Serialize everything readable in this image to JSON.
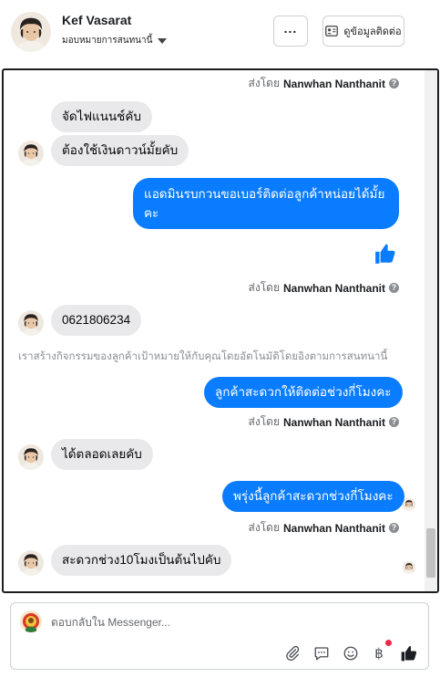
{
  "header": {
    "name": "Kef Vasarat",
    "assign_label": "มอบหมายการสนทนานี้",
    "more_label": "...",
    "contact_button_label": "ดูข้อมูลติดต่อ"
  },
  "sent_by": {
    "prefix": "ส่งโดย",
    "name": "Nanwhan Nanthanit",
    "info_glyph": "?"
  },
  "messages": {
    "m1": "จัดไฟแนนช์คับ",
    "m2": "ต้องใช้เงินดาวน์มั้ยคับ",
    "m3_line1": "แอดมินรบกวนขอเบอร์ติดต่อลูกค้าหน่อยได้มั้ย",
    "m3_line2": "คะ",
    "m4": "0621806234",
    "system_note": "เราสร้างกิจกรรมของลูกค้าเป้าหมายให้กับคุณโดยอัตโนมัติโดยอิงตามการสนทนานี้",
    "m5": "ลูกค้าสะดวกให้ติดต่อช่วงกี่โมงคะ",
    "m6": "ได้ตลอดเลยคับ",
    "m7": "พรุ่งนี้ลูกค้าสะดวกช่วงกี่โมงคะ",
    "m8": "สะดวกช่วง10โมงเป็นต้นไปคับ"
  },
  "composer": {
    "placeholder": "ตอบกลับใน Messenger...",
    "currency_glyph": "฿"
  },
  "colors": {
    "outgoing_bubble": "#0a7cff",
    "incoming_bubble": "#e9e9eb",
    "notification_dot": "#f02849"
  },
  "icons": [
    "avatar",
    "chevron-down-icon",
    "more-icon",
    "contact-card-icon",
    "info-icon",
    "thumbs-up-icon",
    "attachment-icon",
    "comment-icon",
    "emoji-icon",
    "baht-icon",
    "thumbs-up-icon"
  ]
}
